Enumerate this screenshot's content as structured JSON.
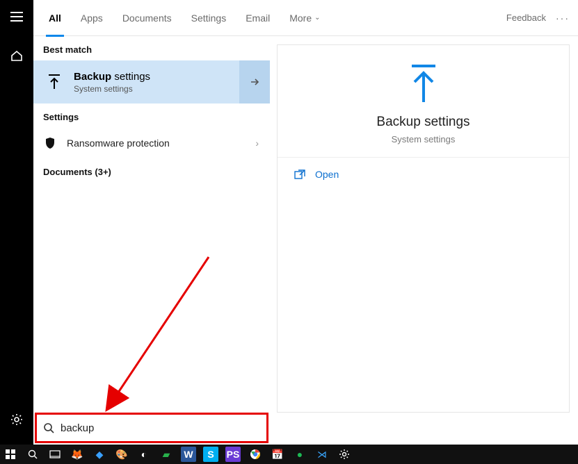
{
  "rail": {
    "hamburger": "hamburger-icon",
    "home": "home-icon",
    "settings": "gear-icon"
  },
  "tabs": {
    "items": [
      "All",
      "Apps",
      "Documents",
      "Settings",
      "Email",
      "More"
    ],
    "active_index": 0,
    "feedback": "Feedback"
  },
  "sections": {
    "best_match_label": "Best match",
    "settings_label": "Settings",
    "documents_label": "Documents (3+)"
  },
  "best_match": {
    "title_bold": "Backup",
    "title_rest": " settings",
    "subtitle": "System settings"
  },
  "settings_rows": [
    {
      "icon": "shield-icon",
      "label": "Ransomware protection"
    }
  ],
  "preview": {
    "title": "Backup settings",
    "subtitle": "System settings",
    "action_label": "Open"
  },
  "search": {
    "value": "backup",
    "placeholder": ""
  },
  "taskbar": {
    "items": [
      "start-icon",
      "search-icon",
      "task-view-icon",
      "firefox-icon",
      "paint-icon",
      "color-picker-icon",
      "unknown-icon",
      "android-icon",
      "word-icon",
      "skype-icon",
      "phpstorm-icon",
      "chrome-icon",
      "calendar-icon",
      "spotify-icon",
      "vscode-icon",
      "settings-icon"
    ]
  },
  "colors": {
    "accent": "#0b87ea",
    "highlight": "#cfe4f7",
    "anno": "#e50000"
  }
}
